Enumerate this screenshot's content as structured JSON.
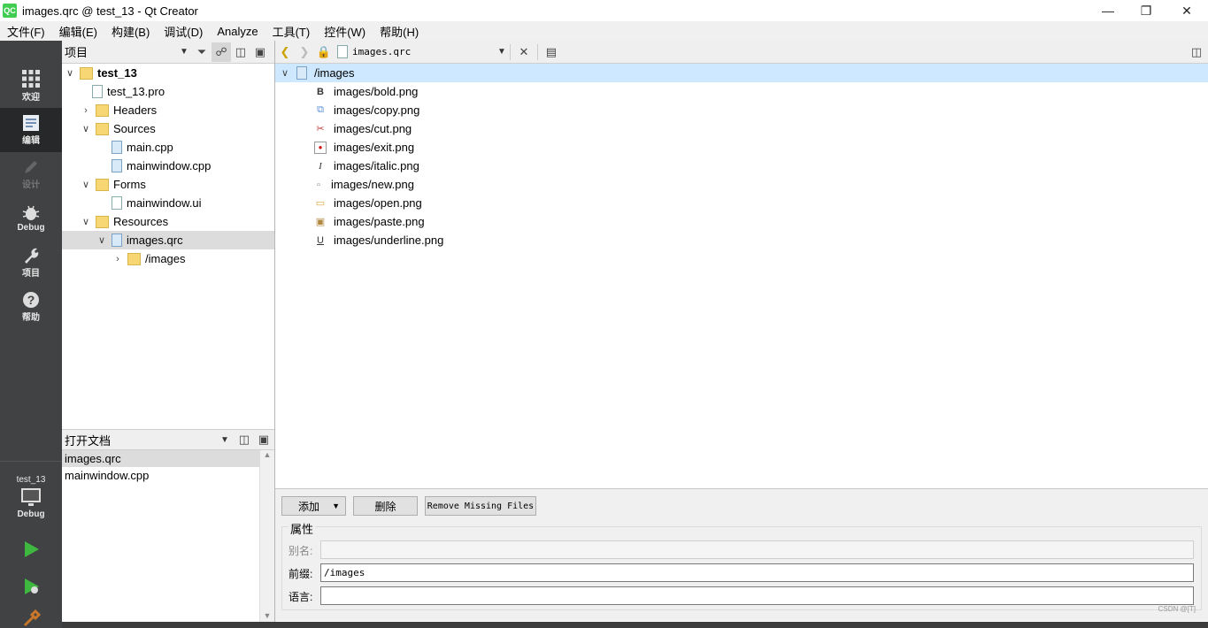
{
  "window": {
    "title": "images.qrc @ test_13 - Qt Creator",
    "app_icon_text": "QC",
    "minimize_icon": "minimize-icon",
    "maximize_icon": "restore-icon",
    "close_icon": "close-icon"
  },
  "menu": [
    "文件(F)",
    "编辑(E)",
    "构建(B)",
    "调试(D)",
    "Analyze",
    "工具(T)",
    "控件(W)",
    "帮助(H)"
  ],
  "modes": [
    {
      "label": "欢迎",
      "icon": "grid-icon"
    },
    {
      "label": "编辑",
      "icon": "edit-icon"
    },
    {
      "label": "设计",
      "icon": "pencil-icon"
    },
    {
      "label": "Debug",
      "icon": "bug-icon"
    },
    {
      "label": "项目",
      "icon": "wrench-icon"
    },
    {
      "label": "帮助",
      "icon": "help-icon"
    }
  ],
  "kit": {
    "project": "test_13",
    "config": "Debug"
  },
  "project_panel": {
    "title": "项目",
    "tree": [
      {
        "label": "test_13",
        "bold": true
      },
      {
        "label": "test_13.pro"
      },
      {
        "label": "Headers"
      },
      {
        "label": "Sources"
      },
      {
        "label": "main.cpp"
      },
      {
        "label": "mainwindow.cpp"
      },
      {
        "label": "Forms"
      },
      {
        "label": "mainwindow.ui"
      },
      {
        "label": "Resources"
      },
      {
        "label": "images.qrc"
      },
      {
        "label": "/images"
      }
    ]
  },
  "open_docs": {
    "title": "打开文档",
    "items": [
      "images.qrc",
      "mainwindow.cpp"
    ]
  },
  "editor": {
    "file_combo": "images.qrc"
  },
  "resource_tree": {
    "prefix": "/images",
    "files": [
      {
        "label": "images/bold.png",
        "icon": "B"
      },
      {
        "label": "images/copy.png",
        "icon": "⧉"
      },
      {
        "label": "images/cut.png",
        "icon": "✂"
      },
      {
        "label": "images/exit.png",
        "icon": "●"
      },
      {
        "label": "images/italic.png",
        "icon": "I"
      },
      {
        "label": "images/new.png",
        "icon": "▫"
      },
      {
        "label": "images/open.png",
        "icon": "▭"
      },
      {
        "label": "images/paste.png",
        "icon": "▣"
      },
      {
        "label": "images/underline.png",
        "icon": "U"
      }
    ]
  },
  "form": {
    "add_label": "添加",
    "remove_label": "删除",
    "remove_missing_label": "Remove Missing Files",
    "group_title": "属性",
    "alias_label": "别名:",
    "alias_value": "",
    "prefix_label": "前缀:",
    "prefix_value": "/images",
    "lang_label": "语言:",
    "lang_value": ""
  },
  "watermark": "CSDN @[T]"
}
